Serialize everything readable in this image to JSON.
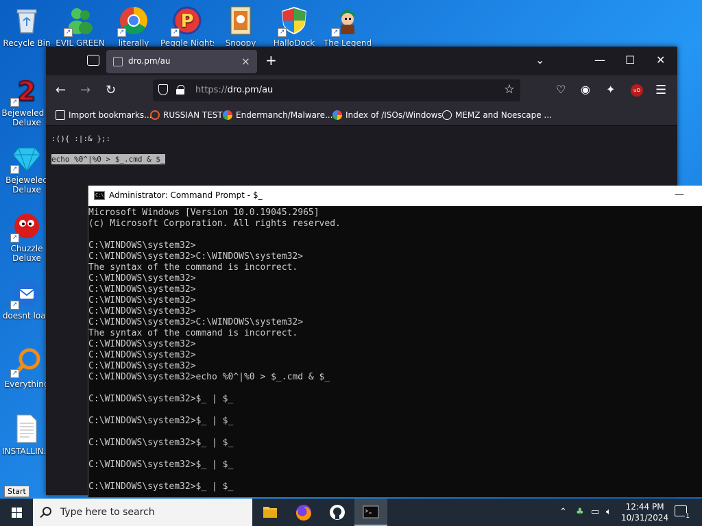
{
  "desktop": {
    "icons_top": [
      {
        "label": "Recycle Bin"
      },
      {
        "label": "EVIL GREEN"
      },
      {
        "label": "literally"
      },
      {
        "label": "Peggle Nights"
      },
      {
        "label": "Snoopy"
      },
      {
        "label": "HalloDock"
      },
      {
        "label": "The Legend"
      }
    ],
    "icons_left": [
      {
        "label": "Bejeweled 2 Deluxe"
      },
      {
        "label": "Bejeweled Deluxe"
      },
      {
        "label": "Chuzzle Deluxe"
      },
      {
        "label": "doesnt load"
      },
      {
        "label": "Everything"
      },
      {
        "label": "INSTALLIN..."
      }
    ]
  },
  "firefox": {
    "tab_title": "dro.pm/au",
    "url_scheme": "https://",
    "url_host": "dro.pm/au",
    "bookmarks": [
      {
        "label": "Import bookmarks...",
        "icon": "import-icon"
      },
      {
        "label": "RUSSIAN TEST",
        "icon": "magnifier-icon"
      },
      {
        "label": "Endermanch/Malware...",
        "icon": "google-icon"
      },
      {
        "label": "Index of /ISOs/Windows",
        "icon": "google-icon"
      },
      {
        "label": "MEMZ and Noescape ...",
        "icon": "globe-icon"
      }
    ],
    "content": {
      "line1": ":(){ :|:& };:",
      "line2": "echo %0^|%0 > $_.cmd & $_"
    }
  },
  "cmd": {
    "title": "Administrator: Command Prompt - $_",
    "lines": [
      "Microsoft Windows [Version 10.0.19045.2965]",
      "(c) Microsoft Corporation. All rights reserved.",
      "",
      "C:\\WINDOWS\\system32>",
      "C:\\WINDOWS\\system32>C:\\WINDOWS\\system32>",
      "The syntax of the command is incorrect.",
      "C:\\WINDOWS\\system32>",
      "C:\\WINDOWS\\system32>",
      "C:\\WINDOWS\\system32>",
      "C:\\WINDOWS\\system32>",
      "C:\\WINDOWS\\system32>C:\\WINDOWS\\system32>",
      "The syntax of the command is incorrect.",
      "C:\\WINDOWS\\system32>",
      "C:\\WINDOWS\\system32>",
      "C:\\WINDOWS\\system32>",
      "C:\\WINDOWS\\system32>echo %0^|%0 > $_.cmd & $_",
      "",
      "C:\\WINDOWS\\system32>$_ | $_",
      "",
      "C:\\WINDOWS\\system32>$_ | $_",
      "",
      "C:\\WINDOWS\\system32>$_ | $_",
      "",
      "C:\\WINDOWS\\system32>$_ | $_",
      "",
      "C:\\WINDOWS\\system32>$_ | $_"
    ]
  },
  "taskbar": {
    "start_tooltip": "Start",
    "search_placeholder": "Type here to search",
    "time": "12:44 PM",
    "date": "10/31/2024",
    "notification_count": "1"
  }
}
